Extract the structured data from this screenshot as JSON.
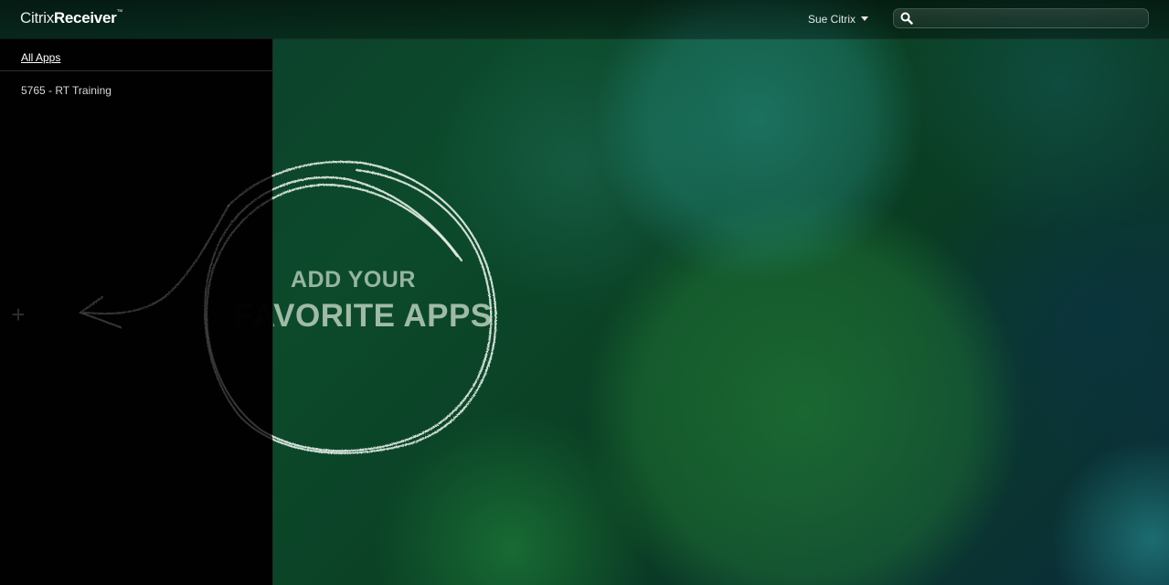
{
  "header": {
    "logo_light": "Citrix",
    "logo_bold": "Receiver",
    "logo_tm": "™",
    "user_name": "Sue Citrix",
    "search": {
      "value": "",
      "placeholder": ""
    }
  },
  "sidebar": {
    "all_apps_label": "All Apps",
    "items": [
      {
        "label": "5765 - RT Training"
      }
    ],
    "add_symbol": "+"
  },
  "main": {
    "hero_line1": "ADD YOUR",
    "hero_line2": "FAVORITE APPS"
  },
  "colors": {
    "background": "#0c4a2b",
    "sidebar": "#000000",
    "hero_text": "#afc8b4",
    "chalk": "#e6f0e8"
  },
  "icons": {
    "search": "search-icon",
    "user_menu": "caret-down-icon",
    "add": "plus-icon"
  }
}
